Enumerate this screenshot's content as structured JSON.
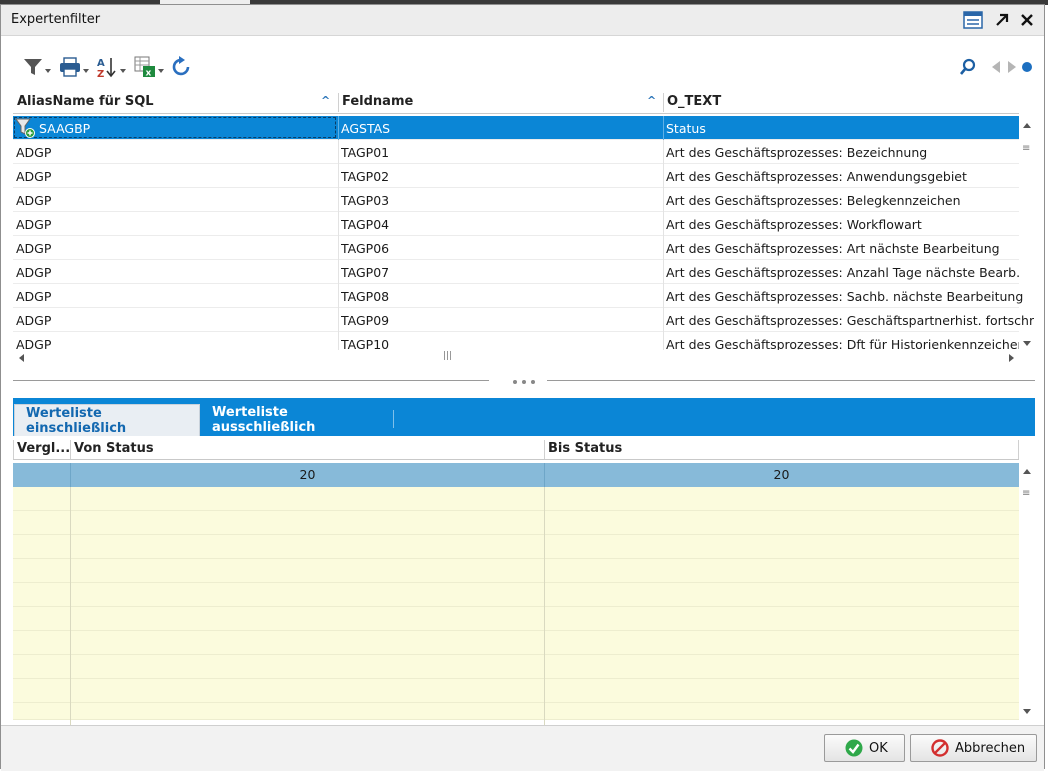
{
  "dialog": {
    "title": "Expertenfilter"
  },
  "upper_grid": {
    "columns": [
      "AliasName für SQL",
      "Feldname",
      "O_TEXT"
    ],
    "rows": [
      [
        "SAAGBP",
        "AGSTAS",
        "Status"
      ],
      [
        "ADGP",
        "TAGP01",
        "Art des Geschäftsprozesses: Bezeichnung"
      ],
      [
        "ADGP",
        "TAGP02",
        "Art des Geschäftsprozesses: Anwendungsgebiet"
      ],
      [
        "ADGP",
        "TAGP03",
        "Art des Geschäftsprozesses: Belegkennzeichen"
      ],
      [
        "ADGP",
        "TAGP04",
        "Art des Geschäftsprozesses: Workflowart"
      ],
      [
        "ADGP",
        "TAGP06",
        "Art des Geschäftsprozesses: Art nächste Bearbeitung"
      ],
      [
        "ADGP",
        "TAGP07",
        "Art des Geschäftsprozesses: Anzahl Tage nächste Bearb."
      ],
      [
        "ADGP",
        "TAGP08",
        "Art des Geschäftsprozesses: Sachb. nächste Bearbeitung"
      ],
      [
        "ADGP",
        "TAGP09",
        "Art des Geschäftsprozesses: Geschäftspartnerhist. fortschr"
      ],
      [
        "ADGP",
        "TAGP10",
        "Art des Geschäftsprozesses: Dft für Historienkennzeichen"
      ]
    ]
  },
  "tabs": [
    {
      "label": "Werteliste einschließlich",
      "active": true
    },
    {
      "label": "Werteliste ausschließlich",
      "active": false
    }
  ],
  "lower_grid": {
    "columns": [
      "Vergl...",
      "Von Status",
      "Bis Status"
    ],
    "rows": [
      [
        "",
        "20",
        "20"
      ]
    ]
  },
  "footer": {
    "ok_label": "OK",
    "cancel_label": "Abbrechen"
  },
  "colors": {
    "accent": "#0b86d6",
    "selected_row": "#0b86d6",
    "value_row": "#87bad9",
    "empty_row": "#fbfbdd"
  },
  "icons": [
    "window-list-icon",
    "popout-icon",
    "close-icon",
    "filter-icon",
    "print-icon",
    "sort-az-icon",
    "excel-export-icon",
    "refresh-icon",
    "search-icon",
    "prev-icon",
    "next-icon",
    "dot-icon",
    "filter-add-icon",
    "ok-check-icon",
    "cancel-forbidden-icon"
  ]
}
